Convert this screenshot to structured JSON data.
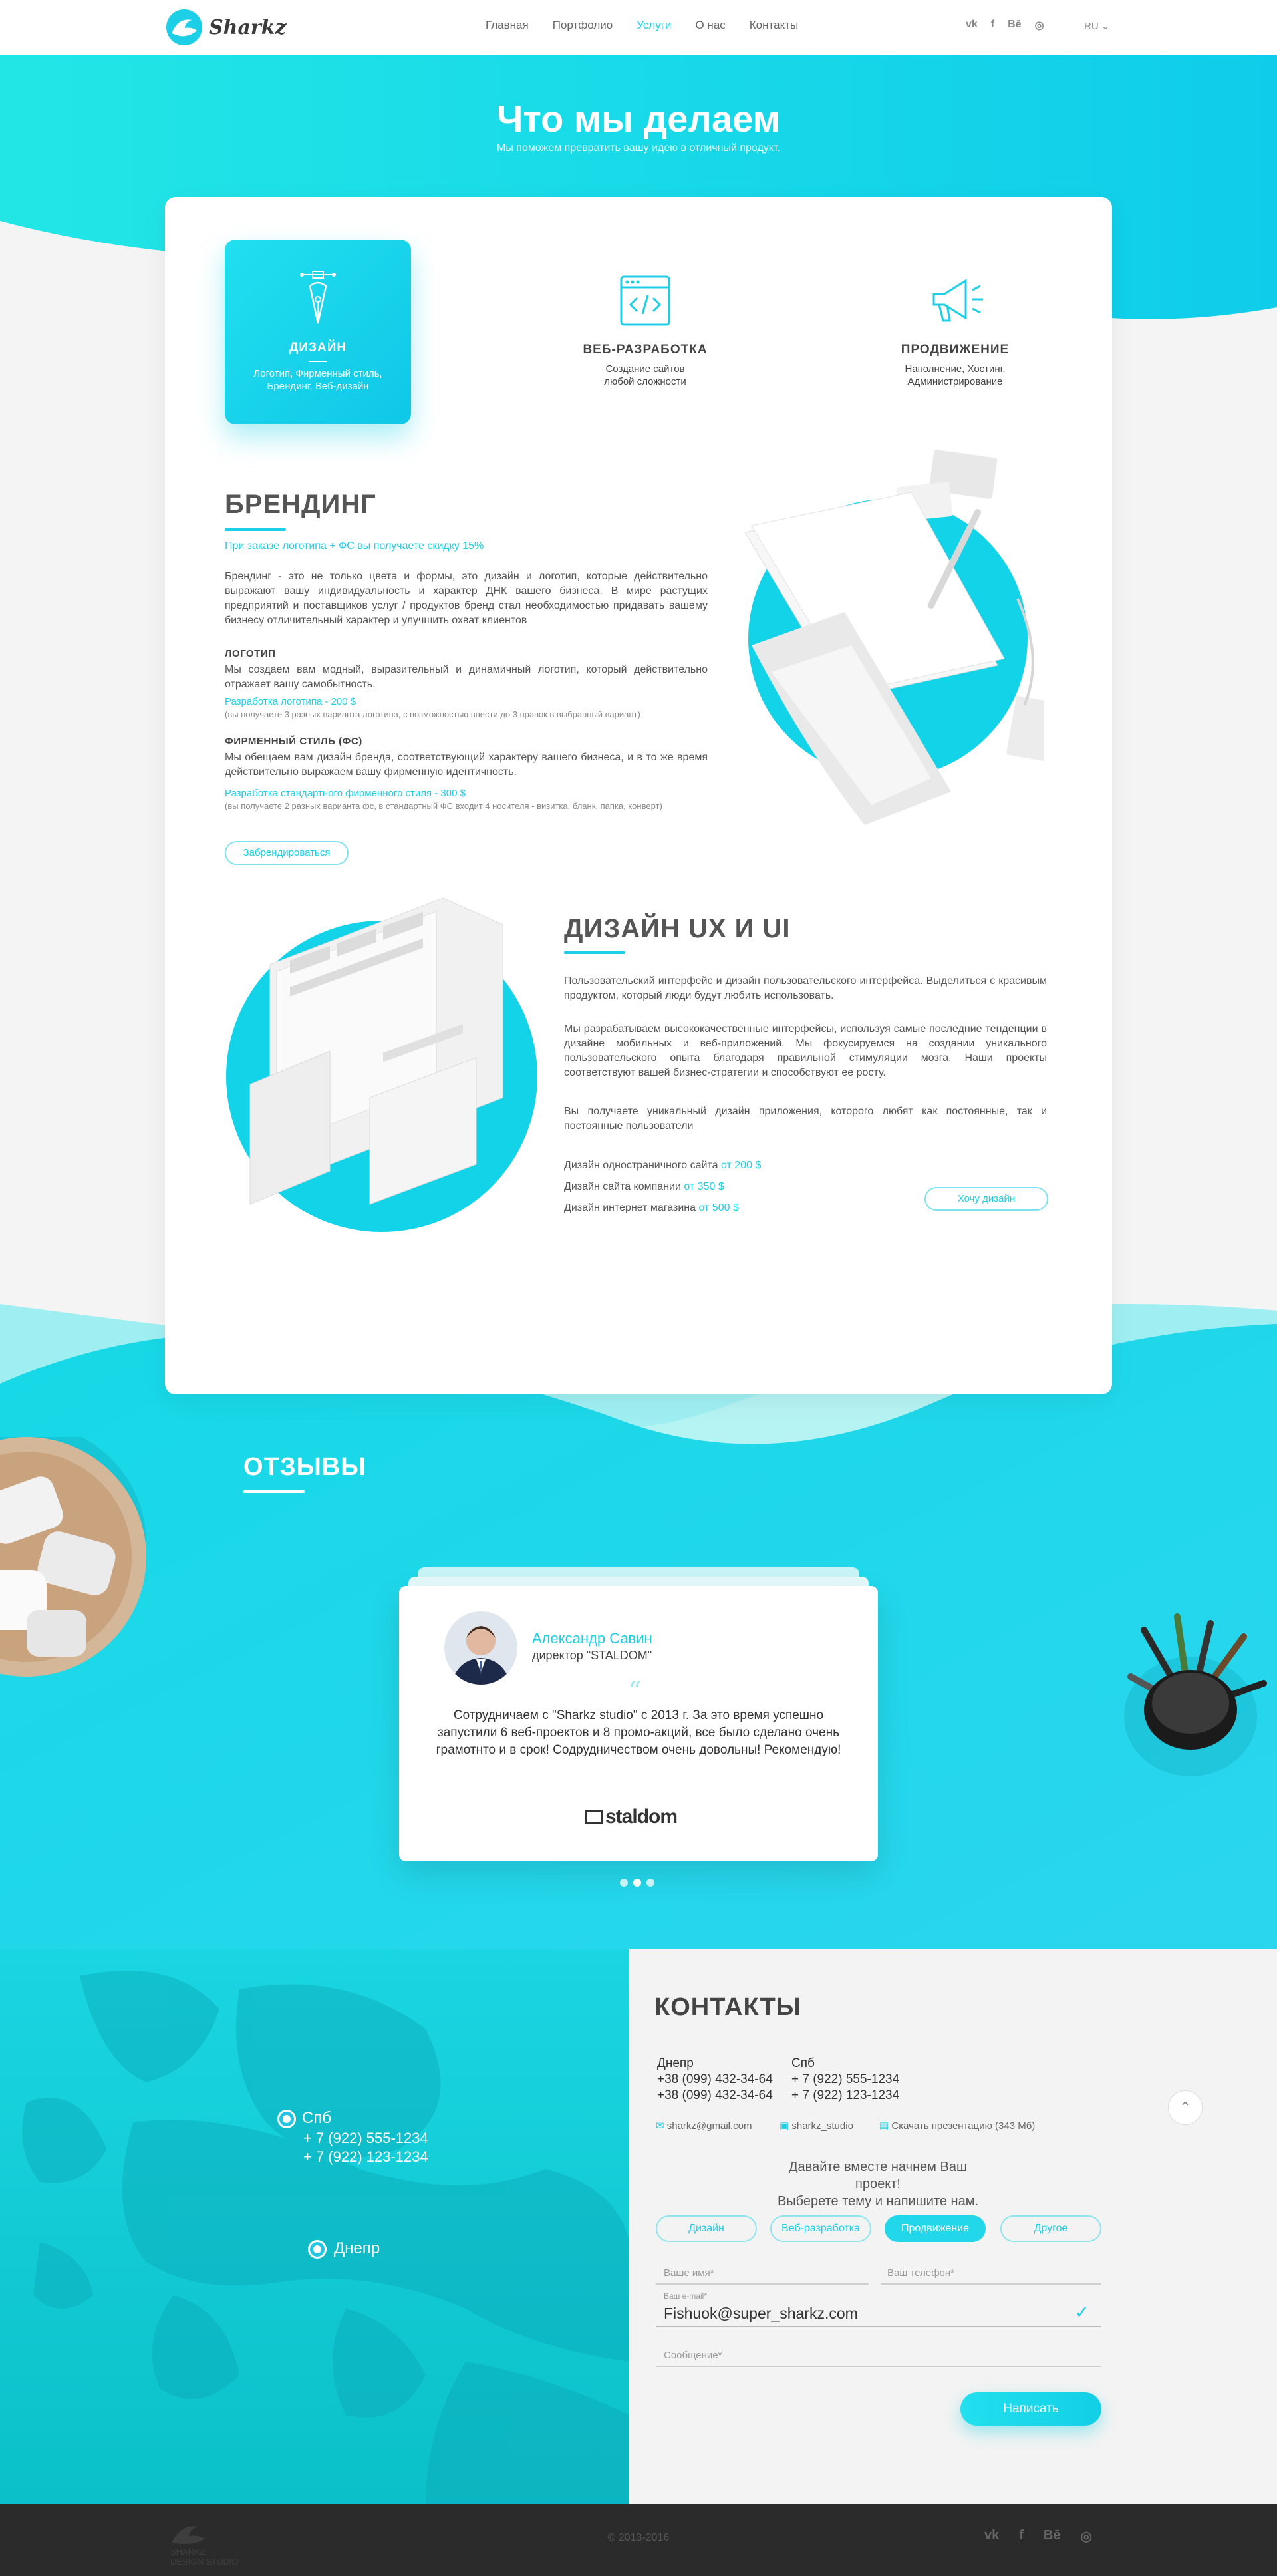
{
  "header": {
    "logo_text": "Sharkz",
    "nav": [
      "Главная",
      "Портфолио",
      "Услуги",
      "О нас",
      "Контакты"
    ],
    "active_nav": "Услуги",
    "social": [
      "vk",
      "f",
      "Bē",
      "◎"
    ],
    "lang": "RU"
  },
  "hero": {
    "title": "Что мы делаем",
    "subtitle": "Мы поможем превратить вашу идею в отличный продукт."
  },
  "services": [
    {
      "title": "ДИЗАЙН",
      "desc": "Логотип, Фирменный стиль, Брендинг, Веб-дизайн",
      "icon": "pen-tool-icon"
    },
    {
      "title": "ВЕБ-РАЗРАБОТКА",
      "desc": "Создание сайтов любой сложности",
      "icon": "code-window-icon"
    },
    {
      "title": "ПРОДВИЖЕНИЕ",
      "desc": "Наполнение, Хостинг, Администрирование",
      "icon": "megaphone-icon"
    }
  ],
  "branding": {
    "title": "БРЕНДИНГ",
    "promo": "При заказе логотипа + ФС вы получаете скидку 15%",
    "intro": "Брендинг - это не только цвета и формы, это дизайн и логотип, которые действительно выражают вашу индивидуальность и характер ДНК вашего бизнеса. В мире растущих предприятий и поставщиков услуг / продуктов бренд стал необходимостью придавать вашему бизнесу отличительный характер и улучшить охват клиентов",
    "logo_heading": "ЛОГОТИП",
    "logo_text": "Мы создаем вам модный, выразительный и динамичный логотип, который действительно отражает вашу самобытность.",
    "logo_price": "Разработка логотипа - 200 $",
    "logo_note": "(вы получаете 3 разных варианта логотипа, с возможностью внести до 3 правок в выбранный вариант)",
    "fs_heading": "ФИРМЕННЫЙ СТИЛЬ (ФС)",
    "fs_text": "Мы обещаем вам дизайн бренда, соответствующий характеру вашего бизнеса, и в то же время действительно выражаем вашу фирменную идентичность.",
    "fs_price": "Разработка стандартного фирменного стиля - 300 $",
    "fs_note": "(вы получаете 2 разных варианта фс, в стандартный ФС входит 4 носителя - визитка, бланк, папка, конверт)",
    "button": "Забрендироваться"
  },
  "uxui": {
    "title": "ДИЗАЙН UX И UI",
    "p1": "Пользовательский интерфейс и дизайн пользовательского интерфейса. Выделиться с красивым продуктом, который люди будут любить использовать.",
    "p2": "Мы разрабатываем высококачественные интерфейсы, используя самые последние тенденции в дизайне мобильных и веб-приложений. Мы фокусируемся на создании уникального пользовательского опыта благодаря правильной стимуляции мозга. Наши проекты соответствуют вашей бизнес-стратегии и способствуют ее росту.",
    "p3": "Вы получаете уникальный дизайн приложения, которого любят как постоянные, так и постоянные пользователи",
    "prices": [
      {
        "label": "Дизайн одностраничного сайта",
        "price": "от 200 $"
      },
      {
        "label": "Дизайн сайта компании",
        "price": "от 350 $"
      },
      {
        "label": "Дизайн интернет магазина",
        "price": "от 500 $"
      }
    ],
    "button": "Хочу дизайн"
  },
  "reviews": {
    "title": "ОТЗЫВЫ",
    "name": "Александр Савин",
    "position": "директор \"STALDOM\"",
    "quote_mark": "“",
    "text": "Сотрудничаем с \"Sharkz studio\" с 2013 г. За это время успешно запустили 6 веб-проектов и 8 промо-акций, все было сделано очень грамотнто и в срок! Содрудничеством очень довольны! Рекомендую!",
    "company_logo": "staldom",
    "slides": 3,
    "active_slide": 2
  },
  "map": {
    "spb_label": "Спб",
    "spb_phones": [
      "+ 7 (922) 555-1234",
      "+ 7 (922) 123-1234"
    ],
    "dnepr_label": "Днепр"
  },
  "contacts": {
    "title": "КОНТАКТЫ",
    "col1_city": "Днепр",
    "col1_phones": [
      "+38 (099) 432-34-64",
      "+38 (099) 432-34-64"
    ],
    "col2_city": "Спб",
    "col2_phones": [
      "+ 7 (922) 555-1234",
      "+ 7 (922) 123-1234"
    ],
    "email": "sharkz@gmail.com",
    "skype": "sharkz_studio",
    "presentation": "Скачать презентацию (343 Мб)",
    "call1": "Давайте вместе начнем Ваш проект!",
    "call2": "Выберете тему и напишите нам.",
    "tags": [
      "Дизайн",
      "Веб-разработка",
      "Продвижение",
      "Другое"
    ],
    "active_tag": "Продвижение",
    "name_label": "Ваше имя*",
    "phone_label": "Ваш телефон*",
    "email_label": "Ваш e-mail*",
    "email_value": "Fishuok@super_sharkz.com",
    "message_label": "Сообщение*",
    "submit": "Написать"
  },
  "footer": {
    "copyright": "© 2013-2016",
    "logo_line1": "SHARKZ",
    "logo_line2": "DESIGN STUDIO",
    "social": [
      "vk",
      "f",
      "Bē",
      "◎"
    ]
  },
  "colors": {
    "accent": "#1ccfe6",
    "accent_light": "#22e0ee",
    "footer": "#2b2b2b"
  }
}
